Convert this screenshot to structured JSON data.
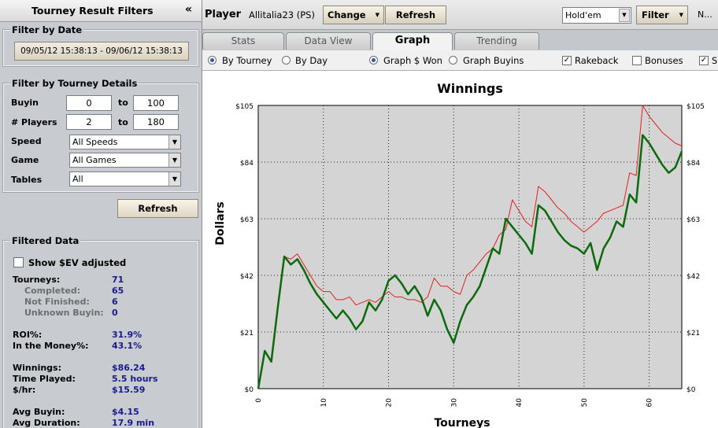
{
  "left_panel": {
    "title": "Tourney Result Filters",
    "collapse_glyph": "«",
    "date_group": {
      "title": "Filter by Date",
      "range_button": "09/05/12 15:38:13 - 09/06/12 15:38:13"
    },
    "tourney_group": {
      "title": "Filter by Tourney Details",
      "buyin_label": "Buyin",
      "buyin_from": "0",
      "buyin_to": "100",
      "players_label": "# Players",
      "players_from": "2",
      "players_to": "180",
      "to_label": "to",
      "speed_label": "Speed",
      "speed_value": "All Speeds",
      "game_label": "Game",
      "game_value": "All Games",
      "tables_label": "Tables",
      "tables_value": "All"
    },
    "refresh_button": "Refresh",
    "filtered_group": {
      "title": "Filtered Data",
      "ev_label": "Show $EV adjusted",
      "stats": [
        {
          "label": "Tourneys:",
          "value": "71",
          "sub": false
        },
        {
          "label": "Completed:",
          "value": "65",
          "sub": true
        },
        {
          "label": "Not Finished:",
          "value": "6",
          "sub": true
        },
        {
          "label": "Unknown Buyin:",
          "value": "0",
          "sub": true
        },
        {
          "label": "ROI%:",
          "value": "31.9%",
          "sub": false
        },
        {
          "label": "In the Money%:",
          "value": "43.1%",
          "sub": false
        },
        {
          "label": "Winnings:",
          "value": "$86.24",
          "sub": false
        },
        {
          "label": "Time Played:",
          "value": "5.5 hours",
          "sub": false
        },
        {
          "label": "$/hr:",
          "value": "$15.59",
          "sub": false
        },
        {
          "label": "Avg Buyin:",
          "value": "$4.15",
          "sub": false
        },
        {
          "label": "Avg Duration:",
          "value": "17.9 min",
          "sub": false
        }
      ]
    }
  },
  "toolbar": {
    "player_label": "Player",
    "player_name": "Allitalia23 (PS)",
    "change_label": "Change",
    "refresh_label": "Refresh",
    "game_select": "Hold'em",
    "filter_label": "Filter",
    "more_label": "N..."
  },
  "tabs": [
    {
      "label": "Stats",
      "active": false
    },
    {
      "label": "Data View",
      "active": false
    },
    {
      "label": "Graph",
      "active": true
    },
    {
      "label": "Trending",
      "active": false
    }
  ],
  "options": {
    "by_tourney": "By Tourney",
    "by_day": "By Day",
    "graph_won": "Graph $ Won",
    "graph_buyins": "Graph Buyins",
    "rakeback": "Rakeback",
    "bonuses": "Bonuses",
    "cut_label": "S"
  },
  "colors": {
    "accent_blue": "#1a1a8c",
    "plot_bg": "#d4d4d4",
    "series_winnings": "#0a6a0a",
    "series_rakeback": "#e02020"
  },
  "chart_data": {
    "type": "line",
    "title": "Winnings",
    "xlabel": "Tourneys",
    "ylabel": "Dollars",
    "xlim": [
      0,
      65
    ],
    "ylim": [
      0,
      105
    ],
    "x_ticks": [
      0,
      10,
      20,
      30,
      40,
      50,
      60
    ],
    "y_ticks": [
      0,
      21,
      42,
      63,
      84,
      105
    ],
    "y_tick_labels": [
      "$0",
      "$21",
      "$42",
      "$63",
      "$84",
      "$105"
    ],
    "grid": true,
    "legend": "none",
    "series": [
      {
        "color": "#e02020",
        "x": [
          0,
          1,
          2,
          3,
          4,
          5,
          6,
          7,
          8,
          9,
          10,
          11,
          12,
          13,
          14,
          15,
          16,
          17,
          18,
          19,
          20,
          21,
          22,
          23,
          24,
          25,
          26,
          27,
          28,
          29,
          30,
          31,
          32,
          33,
          34,
          35,
          36,
          37,
          38,
          39,
          40,
          41,
          42,
          43,
          44,
          45,
          46,
          47,
          48,
          49,
          50,
          51,
          52,
          53,
          54,
          55,
          56,
          57,
          58,
          59,
          60,
          61,
          62,
          63,
          64,
          65
        ],
        "y": [
          0,
          14,
          10,
          30,
          49,
          48,
          50,
          46,
          42,
          38,
          36,
          36,
          33,
          33,
          34,
          31,
          32,
          33,
          32,
          34,
          36,
          34,
          34,
          33,
          33,
          32,
          34,
          41,
          38,
          38,
          36,
          35,
          42,
          44,
          47,
          50,
          52,
          57,
          59,
          70,
          66,
          62,
          60,
          75,
          73,
          70,
          67,
          65,
          62,
          60,
          58,
          60,
          62,
          65,
          66,
          67,
          68,
          80,
          79,
          105,
          101,
          98,
          95,
          93,
          91,
          90
        ]
      },
      {
        "color": "#0a6a0a",
        "x": [
          0,
          1,
          2,
          3,
          4,
          5,
          6,
          7,
          8,
          9,
          10,
          11,
          12,
          13,
          14,
          15,
          16,
          17,
          18,
          19,
          20,
          21,
          22,
          23,
          24,
          25,
          26,
          27,
          28,
          29,
          30,
          31,
          32,
          33,
          34,
          35,
          36,
          37,
          38,
          39,
          40,
          41,
          42,
          43,
          44,
          45,
          46,
          47,
          48,
          49,
          50,
          51,
          52,
          53,
          54,
          55,
          56,
          57,
          58,
          59,
          60,
          61,
          62,
          63,
          64,
          65
        ],
        "y": [
          0,
          14,
          10,
          30,
          49,
          46,
          48,
          44,
          39,
          35,
          32,
          29,
          26,
          29,
          26,
          22,
          25,
          32,
          29,
          33,
          40,
          42,
          39,
          35,
          38,
          34,
          27,
          33,
          29,
          22,
          17,
          25,
          31,
          34,
          38,
          45,
          52,
          50,
          63,
          60,
          57,
          54,
          50,
          68,
          66,
          62,
          58,
          55,
          53,
          52,
          50,
          54,
          44,
          52,
          56,
          62,
          60,
          72,
          69,
          94,
          91,
          87,
          83,
          80,
          82,
          88
        ]
      }
    ]
  }
}
